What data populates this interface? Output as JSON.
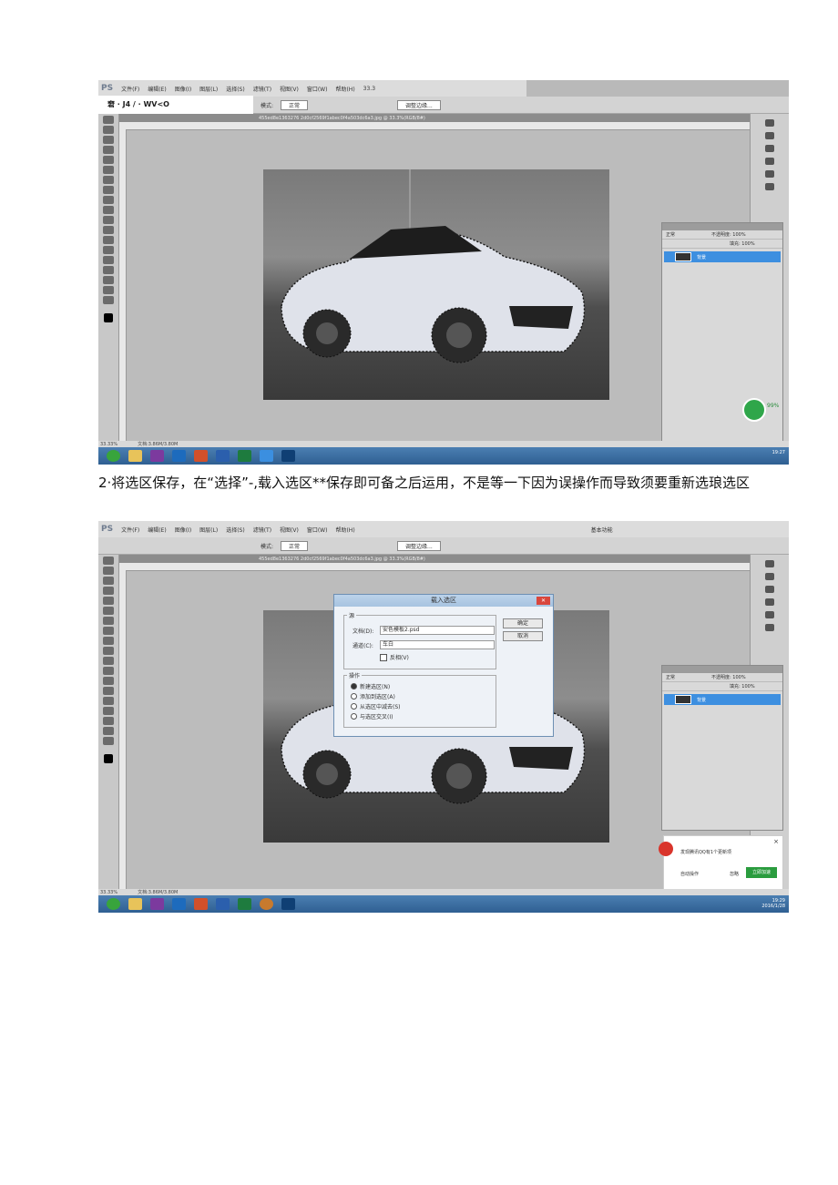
{
  "screenshot1": {
    "menu": [
      "PS",
      "文件(F)",
      "编辑(E)",
      "图像(I)",
      "图层(L)",
      "选择(S)",
      "滤镜(T)",
      "视图(V)",
      "窗口(W)",
      "帮助(H)",
      "33.3"
    ],
    "options": [
      "模式:",
      "正常",
      "调整边缘..."
    ],
    "tab_label": "455ed8e1363276 2d0cf2569f1abec0f4a503dc6a3.jpg @ 33.3%(RGB/8#)",
    "ocr_label": "窘 · J4 / · WV<O",
    "layers_panel": {
      "blend_mode": "正常",
      "opacity_label": "不透明度: 100%",
      "fill_label": "填充: 100%",
      "layer_name": "背景"
    },
    "status": {
      "zoom": "33.33%",
      "doc": "文档:3.86M/3.80M"
    },
    "tray_time": "19:27",
    "cleaner": {
      "percent": "99%"
    }
  },
  "caption": "2·将选区保存，在“选择”-,载入选区**保存即可备之后运用，不是等一下因为误操作而导致须要重新选琅选区",
  "screenshot2": {
    "menu": [
      "PS",
      "文件(F)",
      "编辑(E)",
      "图像(I)",
      "图层(L)",
      "选择(S)",
      "滤镜(T)",
      "视图(V)",
      "窗口(W)",
      "帮助(H)",
      "基本功能"
    ],
    "options": [
      "模式:",
      "正常",
      "调整边缘..."
    ],
    "tab_label": "455ed8e1363276 2d0cf2569f1abec0f4a503dc6a3.jpg @ 33.3%(RGB/8#)",
    "dialog": {
      "title": "载入选区",
      "source_group": "源",
      "doc_label": "文档(D):",
      "doc_value": "安色模板2.psd",
      "channel_label": "通道(C):",
      "channel_value": "车白",
      "invert_label": "反相(V)",
      "ok": "确定",
      "cancel": "取消",
      "op_group": "操作",
      "ops": [
        "新建选区(N)",
        "添加到选区(A)",
        "从选区中减去(S)",
        "与选区交叉(I)"
      ]
    },
    "layers_panel": {
      "blend_mode": "正常",
      "opacity_label": "不透明度: 100%",
      "fill_label": "填充: 100%",
      "layer_name": "背景"
    },
    "status": {
      "zoom": "33.33%",
      "doc": "文档:3.86M/3.80M"
    },
    "qq": {
      "message": "发现腾讯QQ有1个更新项",
      "accelerate": "立即加速",
      "ignore": "忽略",
      "auto": "自动操作"
    },
    "tray_time": "19:29",
    "tray_date": "2016/1/28"
  },
  "colors": {
    "ps_gray": "#b9b9b9",
    "taskbar": "#3a6ea5",
    "layer_select": "#3d8fe0"
  }
}
